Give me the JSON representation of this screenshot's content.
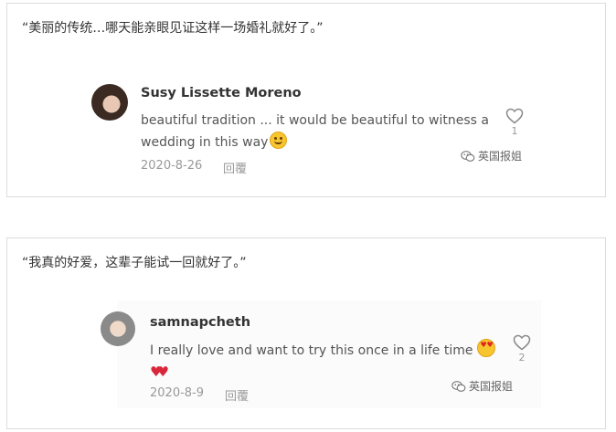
{
  "comments": [
    {
      "quote": "“美丽的传统…哪天能亲眼见证这样一场婚礼就好了。”",
      "username": "Susy Lissette Moreno",
      "text": "beautiful tradition ... it would be beautiful to witness a wedding in this way",
      "date": "2020-8-26",
      "reply_label": "回覆",
      "likes": "1",
      "avatar_icon": "user-avatar",
      "like_icon": "heart-outline-icon"
    },
    {
      "quote": "“我真的好爱，这辈子能试一回就好了。”",
      "username": "samnapcheth",
      "text": "I really love and want to try this once in a life time",
      "date": "2020-8-9",
      "reply_label": "回覆",
      "likes": "2",
      "avatar_icon": "user-avatar",
      "like_icon": "heart-outline-icon"
    }
  ],
  "watermark": {
    "text": "英国报姐",
    "icon": "wechat-icon"
  },
  "colors": {
    "border": "#dcdcdc",
    "text_primary": "#333333",
    "text_secondary": "#555555",
    "meta": "#999999",
    "heart_emoji": "#d8263a"
  }
}
